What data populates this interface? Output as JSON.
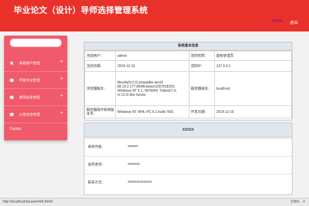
{
  "header": {
    "title": "毕业论文（设计）导师选择管理系统",
    "user": "admin",
    "logout": "退出"
  },
  "sidebar": {
    "items": [
      {
        "label": "系统用户管理",
        "icon": "home-icon"
      },
      {
        "label": "学院专业管理",
        "icon": "folder-icon"
      },
      {
        "label": "教师信息管理",
        "icon": "folder-icon"
      },
      {
        "label": "公告信息管理",
        "icon": "folder-icon"
      }
    ],
    "footer": "Footer"
  },
  "panel1": {
    "title": "系统基本信息",
    "rows": [
      {
        "k1": "当前用户：",
        "v1": "admin",
        "k2": "您的权限：",
        "v2": "超级管理员"
      },
      {
        "k1": "当前日期：",
        "v1": "2019-12-16",
        "k2": "您的IP：",
        "v2": "127.0.0.1"
      },
      {
        "k1": "浏览器版本：",
        "v1": "Mozilla/5.0 (Compatible win32 89.23.2.177.86Windows/1557818150; Windows NT 6.1; WOW64; Trident/7.0; rv:11.0) like Gecko",
        "k2": "服务器域名：",
        "v2": "localhost"
      },
      {
        "k1": "服务器操作系统版本号：",
        "v1": "Windows NT WHL-PC 6.1 build 7601",
        "k2": "开发日期：",
        "v2": "2019-12-16"
      }
    ]
  },
  "panel2": {
    "title": "XXXXX",
    "rows": [
      {
        "k": "系统作者：",
        "v": "xxxxxx"
      },
      {
        "k": "指导老师：",
        "v": "xxxxxxx"
      },
      {
        "k": "联系方式：",
        "v": "xxxxxxxxxxxxxx"
      }
    ]
  },
  "statusbar": {
    "url": "http://localhost/luruwen/left.html#",
    "zoom": "105%"
  }
}
